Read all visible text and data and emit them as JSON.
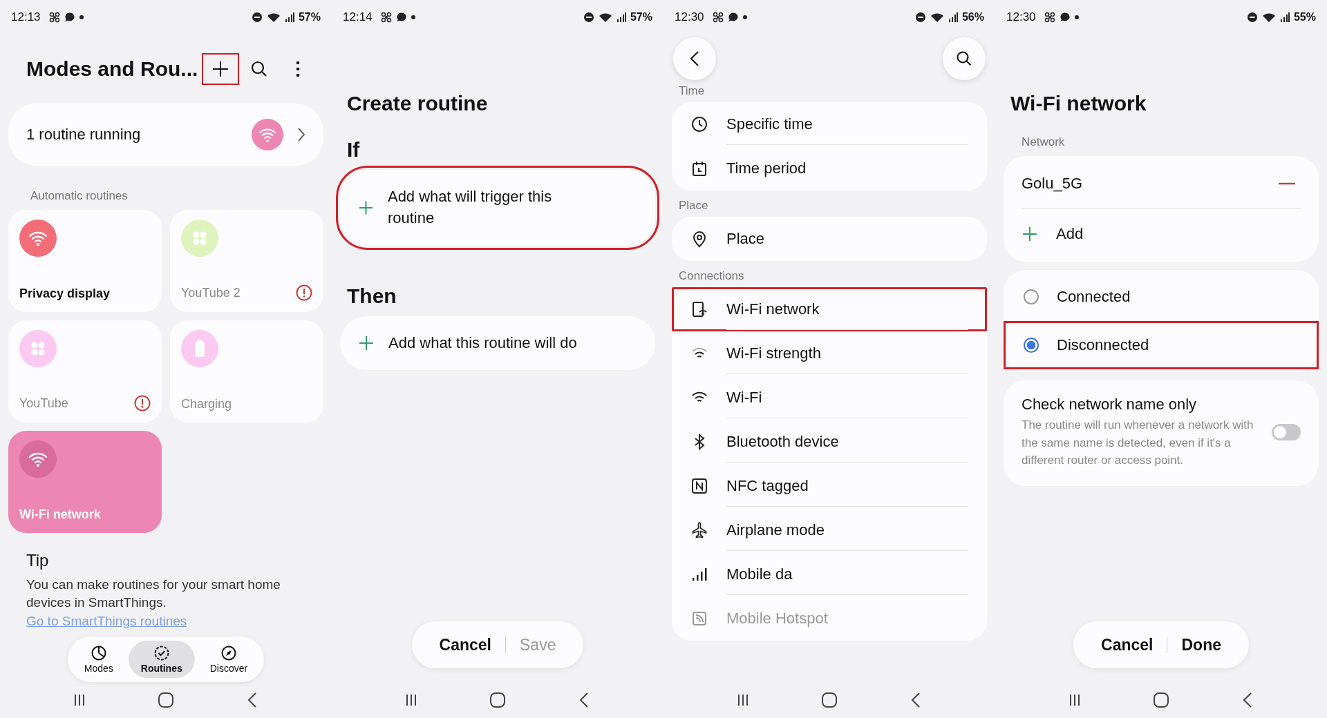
{
  "panels": [
    {
      "kind": "routines",
      "status_bar": {
        "time": "12:13",
        "battery": "57%"
      },
      "title": "Modes and Rou...",
      "actions": [
        {
          "kind": "add",
          "highlighted": true
        },
        {
          "kind": "search",
          "highlighted": false
        },
        {
          "kind": "more",
          "highlighted": false
        }
      ],
      "running_card": {
        "label": "1 routine running"
      },
      "section_label": "Automatic routines",
      "routines": [
        {
          "name": "Privacy display",
          "kind": "wifi",
          "color": "#f26d78",
          "enabled": true,
          "running": false,
          "warning": false
        },
        {
          "name": "YouTube 2",
          "kind": "apps",
          "color": "#dff3be",
          "enabled": false,
          "running": false,
          "warning": true
        },
        {
          "name": "YouTube",
          "kind": "apps",
          "color": "#fbc9f2",
          "enabled": false,
          "running": false,
          "warning": true
        },
        {
          "name": "Charging",
          "kind": "battery",
          "color": "#fbc9f2",
          "enabled": false,
          "running": false,
          "warning": false
        },
        {
          "name": "Wi-Fi network",
          "kind": "wifi",
          "color": "#d86a9c",
          "enabled": true,
          "running": true,
          "warning": false
        }
      ],
      "tip": {
        "title": "Tip",
        "text": "You can make routines for your smart home devices in SmartThings.",
        "link": "Go to SmartThings routines"
      },
      "bottom_nav": [
        {
          "label": "Modes",
          "kind": "modes",
          "selected": false
        },
        {
          "label": "Routines",
          "kind": "routines",
          "selected": true
        },
        {
          "label": "Discover",
          "kind": "discover",
          "selected": false
        }
      ]
    },
    {
      "kind": "create",
      "status_bar": {
        "time": "12:14",
        "battery": "57%"
      },
      "title": "Create routine",
      "if_label": "If",
      "trigger": {
        "label": "Add what will trigger this routine",
        "highlighted": true
      },
      "then_label": "Then",
      "action": {
        "label": "Add what this routine will do",
        "highlighted": false
      },
      "buttons": [
        {
          "label": "Cancel",
          "disabled": false
        },
        {
          "label": "Save",
          "disabled": true
        }
      ]
    },
    {
      "kind": "conditions",
      "status_bar": {
        "time": "12:30",
        "battery": "56%"
      },
      "sections": [
        {
          "label": "Time",
          "items": [
            {
              "label": "Specific time",
              "kind": "clock",
              "highlighted": false
            },
            {
              "label": "Time period",
              "kind": "calendar",
              "highlighted": false
            }
          ]
        },
        {
          "label": "Place",
          "items": [
            {
              "label": "Place",
              "kind": "pin",
              "highlighted": false
            }
          ]
        },
        {
          "label": "Connections",
          "items": [
            {
              "label": "Wi-Fi network",
              "kind": "wifi-phone",
              "highlighted": true
            },
            {
              "label": "Wi-Fi strength",
              "kind": "wifi-weak",
              "highlighted": false
            },
            {
              "label": "Wi-Fi",
              "kind": "wifi",
              "highlighted": false
            },
            {
              "label": "Bluetooth device",
              "kind": "bluetooth",
              "highlighted": false
            },
            {
              "label": "NFC tagged",
              "kind": "nfc",
              "highlighted": false
            },
            {
              "label": "Airplane mode",
              "kind": "airplane",
              "highlighted": false
            },
            {
              "label": "Mobile da",
              "kind": "signal",
              "highlighted": false
            },
            {
              "label": "Mobile Hotspot",
              "kind": "hotspot",
              "highlighted": false
            }
          ]
        }
      ]
    },
    {
      "kind": "wifi",
      "status_bar": {
        "time": "12:30",
        "battery": "55%"
      },
      "title": "Wi-Fi network",
      "network_label": "Network",
      "networks": [
        {
          "name": "Golu_5G"
        }
      ],
      "add_label": "Add",
      "options": [
        {
          "label": "Connected",
          "selected": false,
          "highlighted": false
        },
        {
          "label": "Disconnected",
          "selected": true,
          "highlighted": true
        }
      ],
      "check": {
        "title": "Check network name only",
        "description": "The routine will run whenever a network with the same name is detected, even if it's a different router or access point.",
        "on": false
      },
      "buttons": [
        {
          "label": "Cancel",
          "disabled": false
        },
        {
          "label": "Done",
          "disabled": false
        }
      ]
    }
  ]
}
